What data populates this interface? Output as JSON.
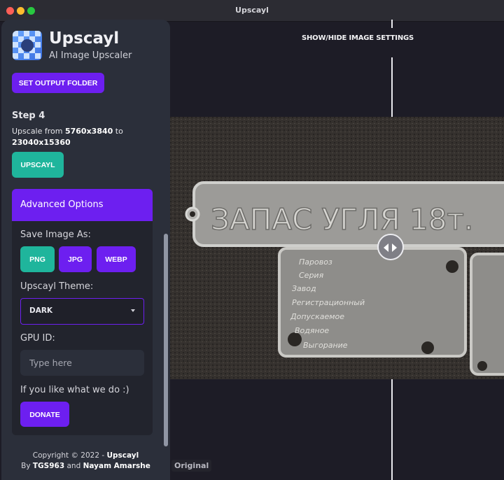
{
  "window": {
    "title": "Upscayl"
  },
  "app": {
    "name": "Upscayl",
    "subtitle": "AI Image Upscaler"
  },
  "sidebar": {
    "set_output_folder": "SET OUTPUT FOLDER",
    "step4": {
      "title": "Step 4",
      "upscale_prefix": "Upscale from ",
      "from_size": "5760x3840",
      "to_word": " to ",
      "to_size": "23040x15360",
      "button": "UPSCAYL"
    },
    "advanced": {
      "title": "Advanced Options",
      "save_as_label": "Save Image As:",
      "formats": [
        "PNG",
        "JPG",
        "WEBP"
      ],
      "theme_label": "Upscayl Theme:",
      "theme_value": "DARK",
      "gpu_label": "GPU ID:",
      "gpu_placeholder": "Type here",
      "donate_label": "If you like what we do :)",
      "donate_button": "DONATE"
    },
    "footer": {
      "copyright": "Copyright © 2022 - ",
      "brand": "Upscayl",
      "by": "By ",
      "author1": "TGS963",
      "and": " and ",
      "author2": "Nayam Amarshe"
    }
  },
  "main": {
    "toggle_settings": "SHOW/HIDE IMAGE SETTINGS",
    "original_label": "Original",
    "plate_big": "ЗАПАС УГЛЯ   18т.",
    "plate_small": [
      "Паровоз",
      "Серия",
      "Завод",
      "Регистрационный",
      "Допускаемое",
      "Водяное",
      "Выгорание"
    ]
  },
  "colors": {
    "accent": "#6d1ff0",
    "teal": "#1fb59c",
    "sidebar_bg": "#2b2f3a",
    "main_bg": "#1d1c26"
  },
  "icons": {
    "logo": "upscayl-logo-icon",
    "compare_handle": "left-right-arrows-icon",
    "theme_caret": "caret-down-icon"
  }
}
